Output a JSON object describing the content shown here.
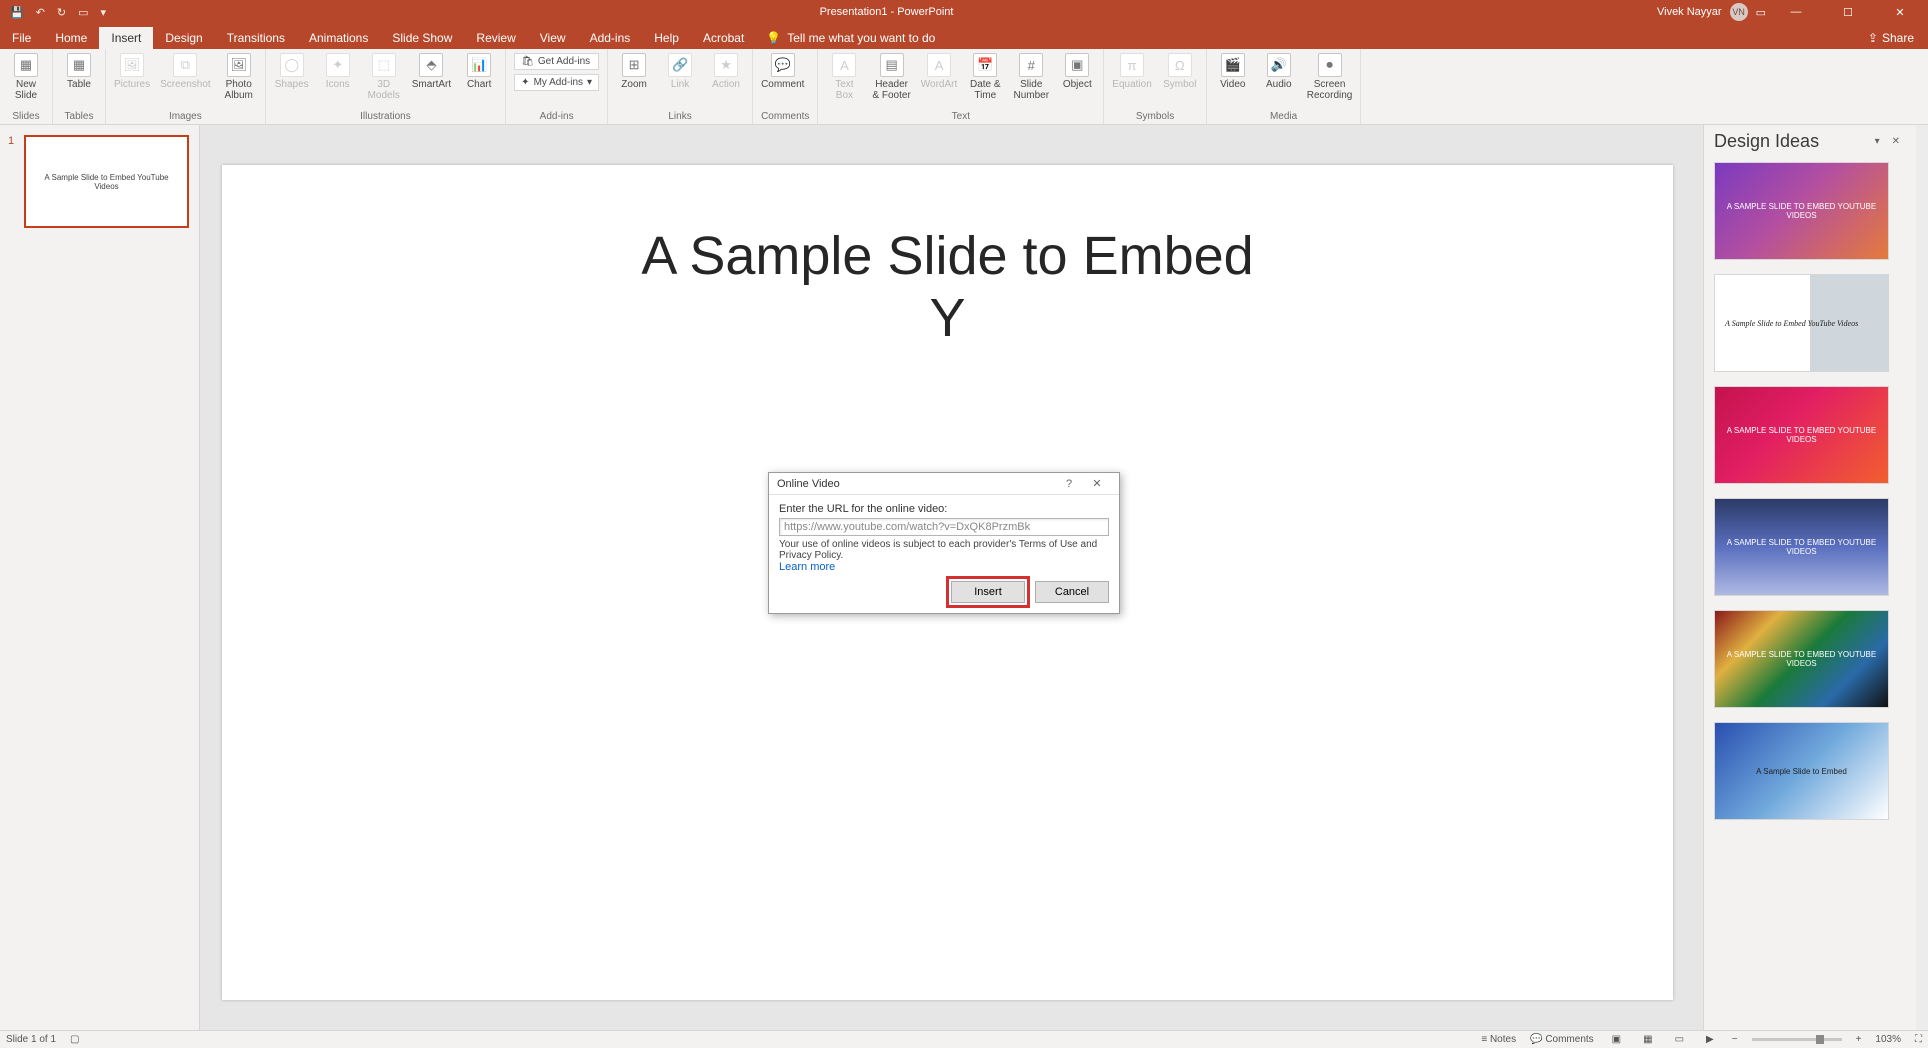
{
  "titlebar": {
    "doc_title": "Presentation1 - PowerPoint",
    "user_name": "Vivek Nayyar",
    "user_initials": "VN"
  },
  "tabs": {
    "file": "File",
    "home": "Home",
    "insert": "Insert",
    "design": "Design",
    "transitions": "Transitions",
    "animations": "Animations",
    "slideshow": "Slide Show",
    "review": "Review",
    "view": "View",
    "addins": "Add-ins",
    "help": "Help",
    "acrobat": "Acrobat",
    "tellme": "Tell me what you want to do",
    "share": "Share"
  },
  "ribbon": {
    "slides": {
      "new_slide": "New\nSlide",
      "group": "Slides"
    },
    "tables": {
      "table": "Table",
      "group": "Tables"
    },
    "images": {
      "pictures": "Pictures",
      "screenshot": "Screenshot",
      "photo_album": "Photo\nAlbum",
      "group": "Images"
    },
    "illustrations": {
      "shapes": "Shapes",
      "icons": "Icons",
      "models": "3D\nModels",
      "smartart": "SmartArt",
      "chart": "Chart",
      "group": "Illustrations"
    },
    "addins": {
      "get": "Get Add-ins",
      "my": "My Add-ins",
      "group": "Add-ins"
    },
    "links": {
      "zoom": "Zoom",
      "link": "Link",
      "action": "Action",
      "group": "Links"
    },
    "comments": {
      "comment": "Comment",
      "group": "Comments"
    },
    "text": {
      "textbox": "Text\nBox",
      "header": "Header\n& Footer",
      "wordart": "WordArt",
      "date": "Date &\nTime",
      "slidenum": "Slide\nNumber",
      "object": "Object",
      "group": "Text"
    },
    "symbols": {
      "equation": "Equation",
      "symbol": "Symbol",
      "group": "Symbols"
    },
    "media": {
      "video": "Video",
      "audio": "Audio",
      "screen": "Screen\nRecording",
      "group": "Media"
    }
  },
  "thumb": {
    "num": "1",
    "text": "A Sample Slide to Embed YouTube Videos"
  },
  "slide": {
    "title_line1": "A Sample Slide to Embed",
    "title_line2": "Y"
  },
  "dialog": {
    "title": "Online Video",
    "prompt": "Enter the URL for the online video:",
    "url_value": "https://www.youtube.com/watch?v=DxQK8PrzmBk",
    "terms": "Your use of online videos is subject to each provider's Terms of Use and Privacy Policy.",
    "learn": "Learn more",
    "insert": "Insert",
    "cancel": "Cancel"
  },
  "pane": {
    "title": "Design Ideas",
    "idea_text_upper": "A SAMPLE SLIDE TO EMBED YOUTUBE VIDEOS",
    "idea_text_serif": "A Sample Slide to Embed YouTube Videos",
    "idea_text_mixed": "A Sample Slide to Embed"
  },
  "status": {
    "slide": "Slide 1 of 1",
    "notes": "Notes",
    "comments": "Comments",
    "zoom": "103%"
  }
}
